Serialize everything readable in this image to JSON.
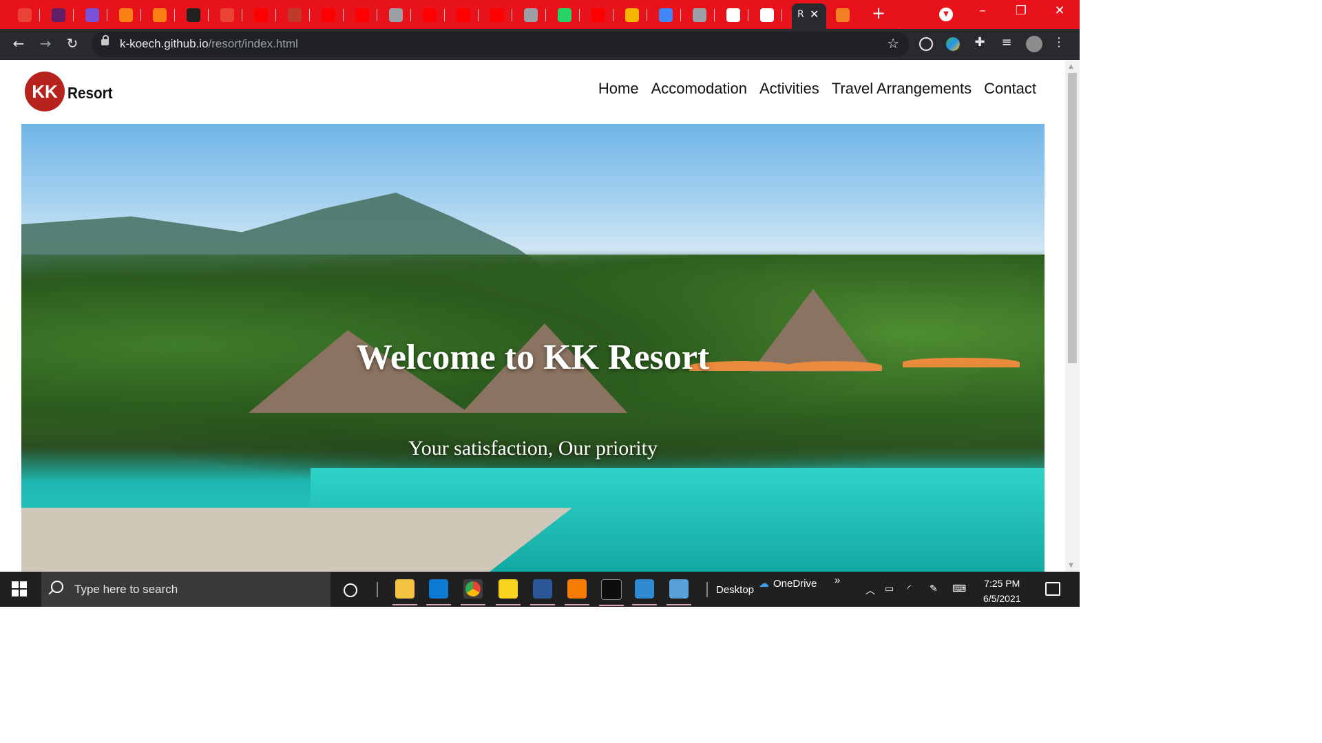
{
  "browser": {
    "tabs": [
      {
        "icon": "gmail-icon",
        "color": "#ea4335"
      },
      {
        "icon": "slack-icon",
        "color": "#611f69"
      },
      {
        "icon": "tool-icon",
        "color": "#7b4fd6"
      },
      {
        "icon": "moodle-icon",
        "color": "#f98012"
      },
      {
        "icon": "moodle-icon",
        "color": "#f98012"
      },
      {
        "icon": "bug-icon",
        "color": "#222222"
      },
      {
        "icon": "gmail-icon",
        "color": "#ea4335"
      },
      {
        "icon": "youtube-icon",
        "color": "#ff0000"
      },
      {
        "icon": "pin-icon",
        "color": "#c0392b"
      },
      {
        "icon": "youtube-icon",
        "color": "#ff0000"
      },
      {
        "icon": "youtube-icon",
        "color": "#ff0000"
      },
      {
        "icon": "globe-icon",
        "color": "#9aa0a6"
      },
      {
        "icon": "youtube-icon",
        "color": "#ff0000"
      },
      {
        "icon": "youtube-icon",
        "color": "#ff0000"
      },
      {
        "icon": "youtube-icon",
        "color": "#ff0000"
      },
      {
        "icon": "globe-icon",
        "color": "#9aa0a6"
      },
      {
        "icon": "whatsapp-icon",
        "color": "#25d366"
      },
      {
        "icon": "youtube-icon",
        "color": "#ff0000"
      },
      {
        "icon": "pencil-icon",
        "color": "#f4b400"
      },
      {
        "icon": "google-icon",
        "color": "#4285f4"
      },
      {
        "icon": "globe-icon",
        "color": "#9aa0a6"
      },
      {
        "icon": "audio-icon",
        "color": "#ffffff"
      },
      {
        "icon": "github-icon",
        "color": "#ffffff"
      }
    ],
    "active_tab": {
      "title": "R",
      "close": "✕"
    },
    "extra_tab_icon": "stackoverflow-icon",
    "new_tab": "+",
    "url_host": "k-koech.github.io",
    "url_path": "/resort/index.html",
    "window": {
      "minimize": "–",
      "restore": "❐",
      "close": "✕"
    }
  },
  "site": {
    "logo_initials": "KK",
    "logo_name": "Resort",
    "nav": [
      "Home",
      "Accomodation",
      "Activities",
      "Travel Arrangements",
      "Contact"
    ],
    "hero_title": "Welcome to KK Resort",
    "hero_subtitle": "Your satisfaction, Our priority"
  },
  "taskbar": {
    "search_placeholder": "Type here to search",
    "desktop_label": "Desktop",
    "onedrive_label": "OneDrive",
    "time": "7:25 PM",
    "date": "6/5/2021",
    "chevron": "»"
  },
  "colors": {
    "tab_strip": "#e8131a",
    "logo": "#b5231c",
    "toolbar": "#292a2d"
  }
}
